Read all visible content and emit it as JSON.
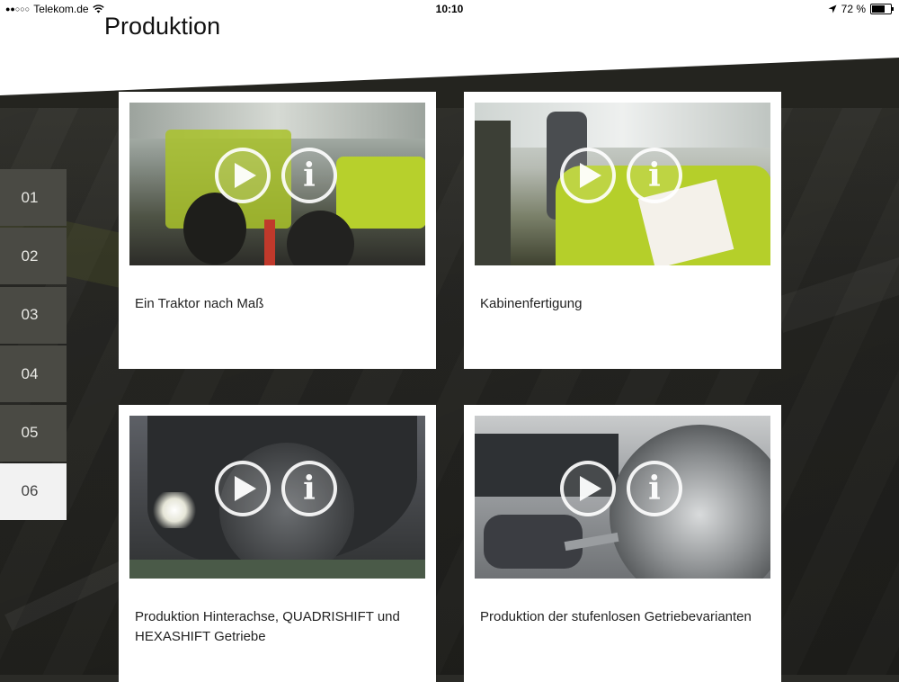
{
  "status_bar": {
    "carrier": "Telekom.de",
    "time": "10:10",
    "battery": "72 %",
    "battery_level": 0.72
  },
  "page": {
    "title": "Produktion"
  },
  "nav": {
    "items": [
      {
        "label": "01"
      },
      {
        "label": "02"
      },
      {
        "label": "03"
      },
      {
        "label": "04"
      },
      {
        "label": "05"
      },
      {
        "label": "06"
      }
    ],
    "active_index": 5
  },
  "cards": [
    {
      "caption": "Ein Traktor nach Maß",
      "play_icon": "play-icon",
      "info_icon": "info-icon"
    },
    {
      "caption": "Kabinenfertigung",
      "play_icon": "play-icon",
      "info_icon": "info-icon"
    },
    {
      "caption": "Produktion Hinterachse, QUADRISHIFT und HEXASHIFT Getriebe",
      "play_icon": "play-icon",
      "info_icon": "info-icon"
    },
    {
      "caption": "Produktion der stufenlosen Getriebevarianten",
      "play_icon": "play-icon",
      "info_icon": "info-icon"
    }
  ],
  "colors": {
    "accent_green": "#b5cf2a",
    "nav_bg": "#4a4a44",
    "nav_active_bg": "#f2f2f2"
  }
}
